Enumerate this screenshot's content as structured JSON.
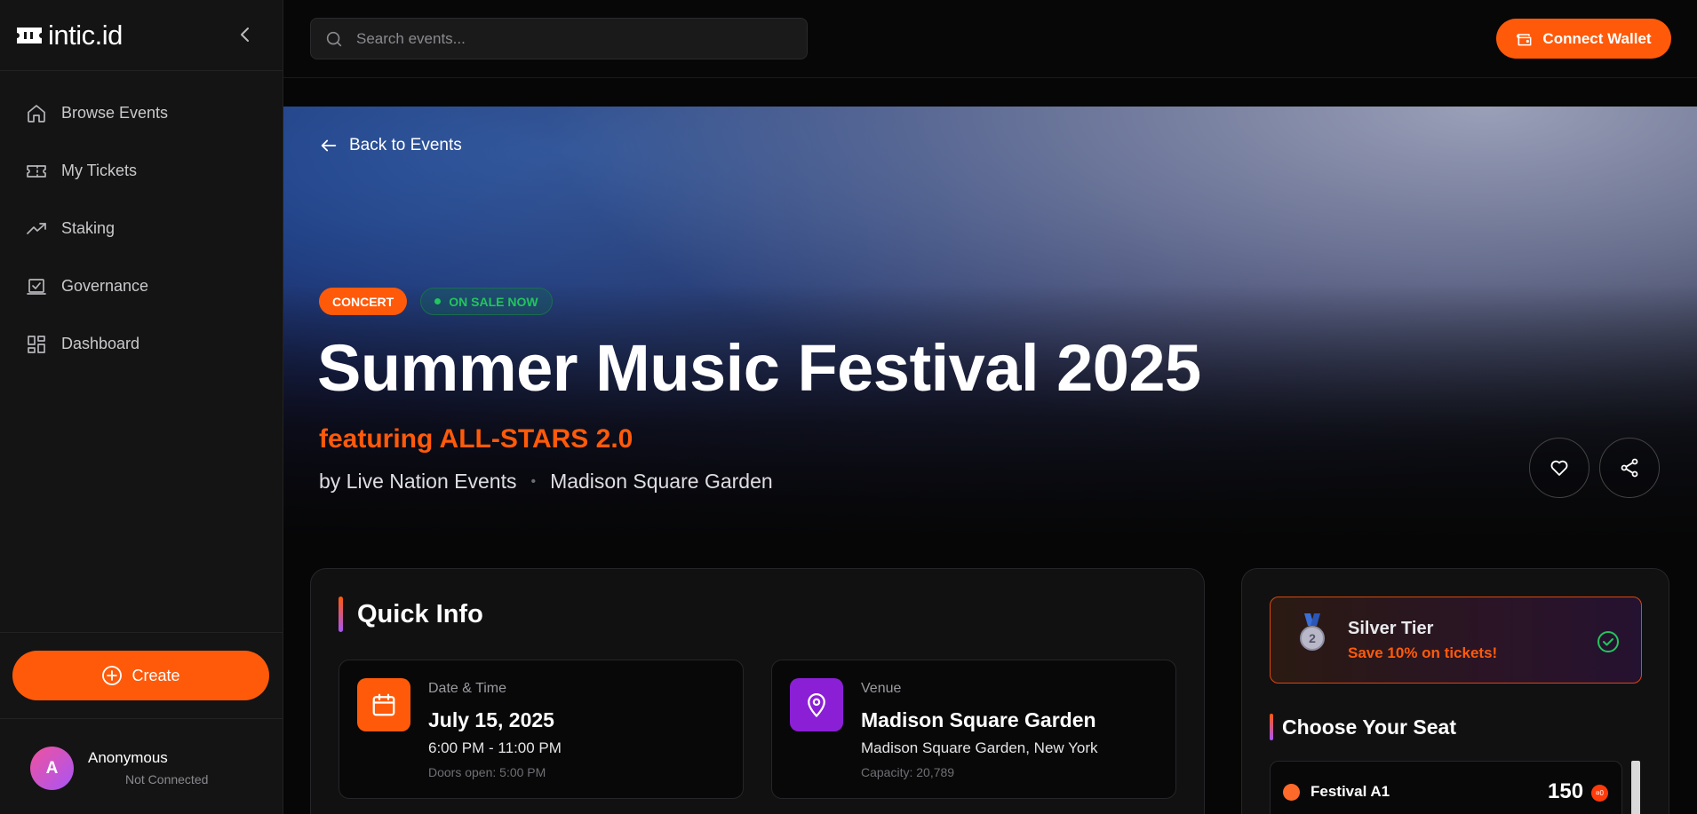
{
  "app": {
    "brand": "intic.id"
  },
  "sidebar": {
    "items": [
      {
        "label": "Browse Events",
        "icon": "home-icon"
      },
      {
        "label": "My Tickets",
        "icon": "ticket-icon"
      },
      {
        "label": "Staking",
        "icon": "trending-up-icon"
      },
      {
        "label": "Governance",
        "icon": "vote-icon"
      },
      {
        "label": "Dashboard",
        "icon": "dashboard-icon"
      }
    ],
    "create_label": "Create",
    "user": {
      "avatar_initial": "A",
      "name": "Anonymous",
      "status": "Not Connected"
    }
  },
  "topbar": {
    "search_placeholder": "Search events...",
    "wallet_label": "Connect Wallet"
  },
  "hero": {
    "back_label": "Back to Events",
    "category_badge": "CONCERT",
    "status_badge": "ON SALE NOW",
    "title": "Summer Music Festival 2025",
    "featuring": "featuring ALL-STARS 2.0",
    "organizer": "by Live Nation Events",
    "separator": "•",
    "venue": "Madison Square Garden"
  },
  "quick_info": {
    "title": "Quick Info",
    "date": {
      "label": "Date & Time",
      "main": "July 15, 2025",
      "sub": "6:00 PM - 11:00 PM",
      "small": "Doors open: 5:00 PM"
    },
    "venue": {
      "label": "Venue",
      "main": "Madison Square Garden",
      "sub": "Madison Square Garden, New York",
      "small": "Capacity: 20,789"
    }
  },
  "tier": {
    "name": "Silver Tier",
    "saving": "Save 10% on tickets!",
    "medal_number": "2"
  },
  "seats": {
    "title": "Choose Your Seat",
    "items": [
      {
        "name": "Festival A1",
        "price": "150",
        "currency_symbol": "¤0"
      }
    ]
  },
  "colors": {
    "accent": "#ff5a0a",
    "purple": "#a855f7",
    "success": "#22c55e",
    "background": "#060606",
    "sidebar": "#141414"
  }
}
